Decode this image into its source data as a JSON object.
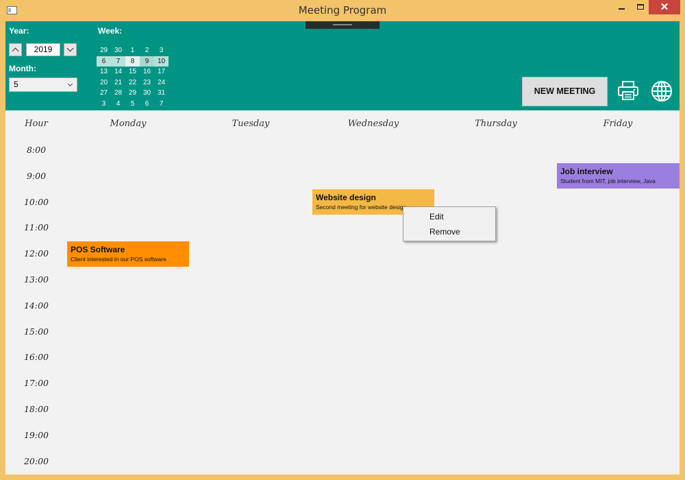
{
  "window": {
    "title": "Meeting Program",
    "close_label": "✕"
  },
  "header": {
    "year_label": "Year:",
    "year_value": "2019",
    "month_label": "Month:",
    "month_value": "5",
    "week_label": "Week:",
    "weeks": [
      [
        "29",
        "30",
        "1",
        "2",
        "3"
      ],
      [
        "6",
        "7",
        "8",
        "9",
        "10"
      ],
      [
        "13",
        "14",
        "15",
        "16",
        "17"
      ],
      [
        "20",
        "21",
        "22",
        "23",
        "24"
      ],
      [
        "27",
        "28",
        "29",
        "30",
        "31"
      ],
      [
        "3",
        "4",
        "5",
        "6",
        "7"
      ]
    ],
    "selected_week_index": 1,
    "new_meeting_label": "NEW MEETING",
    "print_icon": "printer-icon",
    "globe_icon": "globe-icon"
  },
  "calendar": {
    "hour_header": "Hour",
    "days": [
      "Monday",
      "Tuesday",
      "Wednesday",
      "Thursday",
      "Friday"
    ],
    "hours": [
      "8:00",
      "9:00",
      "10:00",
      "11:00",
      "12:00",
      "13:00",
      "14:00",
      "15:00",
      "16:00",
      "17:00",
      "18:00",
      "19:00",
      "20:00"
    ],
    "events": [
      {
        "title": "POS Software",
        "description": "Client interested in our POS software",
        "day": "Monday",
        "start": "12:00",
        "color": "#ff8f00"
      },
      {
        "title": "Website design",
        "description": "Second meeting for website design",
        "day": "Wednesday",
        "start": "10:00",
        "color": "#f3b845"
      },
      {
        "title": "Job interview",
        "description": "Student from MIT, job interview, Java",
        "day": "Friday",
        "start": "9:00",
        "color": "#9b7fe0"
      }
    ]
  },
  "context_menu": {
    "items": [
      "Edit",
      "Remove"
    ]
  },
  "colors": {
    "header_bg": "#009484",
    "window_frame": "#f3c36a",
    "close_button": "#c7453c"
  }
}
